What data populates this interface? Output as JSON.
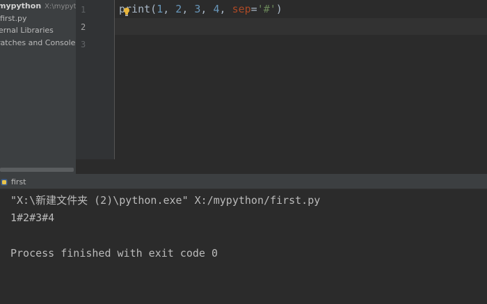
{
  "project_tree": {
    "root_name": "mypython",
    "root_path": "X:\\mypython",
    "items": [
      {
        "label": "first.py"
      },
      {
        "label": "ernal Libraries"
      },
      {
        "label": "ratches and Consoles"
      }
    ]
  },
  "editor": {
    "line_numbers": [
      "1",
      "2",
      "3"
    ],
    "code": {
      "func": "print",
      "open_paren": "(",
      "args": [
        "1",
        "2",
        "3",
        "4"
      ],
      "sep_comma": ", ",
      "kw_name": "sep",
      "equals": "=",
      "str_value": "'#'",
      "close_paren": ")"
    }
  },
  "run_panel": {
    "tab_label": "first",
    "console_lines": [
      "\"X:\\新建文件夹 (2)\\python.exe\" X:/mypython/first.py",
      "1#2#3#4",
      "",
      "Process finished with exit code 0"
    ]
  },
  "colors": {
    "background": "#2b2b2b",
    "panel": "#3c3f41",
    "number": "#6897bb",
    "keyword_arg": "#aa4926",
    "string": "#6a8759",
    "run_icon": "#59a869"
  }
}
